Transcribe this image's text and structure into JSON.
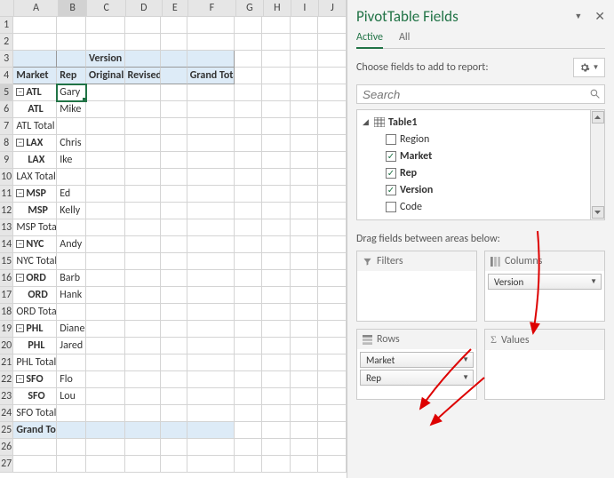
{
  "columns": [
    "A",
    "B",
    "C",
    "D",
    "E",
    "F",
    "G",
    "H",
    "I",
    "J"
  ],
  "row_count": 27,
  "selected_cell": {
    "row": 5,
    "col": "B"
  },
  "pivot_headers": {
    "version_label": "Version",
    "market_label": "Market",
    "rep_label": "Rep",
    "original": "Original",
    "revised": "Revised",
    "grand_total_col": "Grand Total"
  },
  "pivot_rows": [
    {
      "type": "group",
      "market": "ATL",
      "rep": "Gary"
    },
    {
      "type": "child",
      "market": "ATL",
      "rep": "Mike"
    },
    {
      "type": "total",
      "label": "ATL Total"
    },
    {
      "type": "group",
      "market": "LAX",
      "rep": "Chris"
    },
    {
      "type": "child",
      "market": "LAX",
      "rep": "Ike"
    },
    {
      "type": "total",
      "label": "LAX Total"
    },
    {
      "type": "group",
      "market": "MSP",
      "rep": "Ed"
    },
    {
      "type": "child",
      "market": "MSP",
      "rep": "Kelly"
    },
    {
      "type": "total",
      "label": "MSP Total"
    },
    {
      "type": "group",
      "market": "NYC",
      "rep": "Andy"
    },
    {
      "type": "total",
      "label": "NYC Total"
    },
    {
      "type": "group",
      "market": "ORD",
      "rep": "Barb"
    },
    {
      "type": "child",
      "market": "ORD",
      "rep": "Hank"
    },
    {
      "type": "total",
      "label": "ORD Total"
    },
    {
      "type": "group",
      "market": "PHL",
      "rep": "Diane"
    },
    {
      "type": "child",
      "market": "PHL",
      "rep": "Jared"
    },
    {
      "type": "total",
      "label": "PHL Total"
    },
    {
      "type": "group",
      "market": "SFO",
      "rep": "Flo"
    },
    {
      "type": "child",
      "market": "SFO",
      "rep": "Lou"
    },
    {
      "type": "total",
      "label": "SFO Total"
    },
    {
      "type": "grand",
      "label": "Grand Total"
    }
  ],
  "fields_pane": {
    "title": "PivotTable Fields",
    "tabs": {
      "active": "Active",
      "all": "All"
    },
    "choose_label": "Choose fields to add to report:",
    "search_placeholder": "Search",
    "table_name": "Table1",
    "fields": [
      {
        "name": "Region",
        "checked": false
      },
      {
        "name": "Market",
        "checked": true
      },
      {
        "name": "Rep",
        "checked": true
      },
      {
        "name": "Version",
        "checked": true
      },
      {
        "name": "Code",
        "checked": false
      }
    ],
    "drag_label": "Drag fields between areas below:",
    "areas": {
      "filters_title": "Filters",
      "columns_title": "Columns",
      "rows_title": "Rows",
      "values_title": "Values",
      "columns_pills": [
        "Version"
      ],
      "rows_pills": [
        "Market",
        "Rep"
      ]
    }
  }
}
